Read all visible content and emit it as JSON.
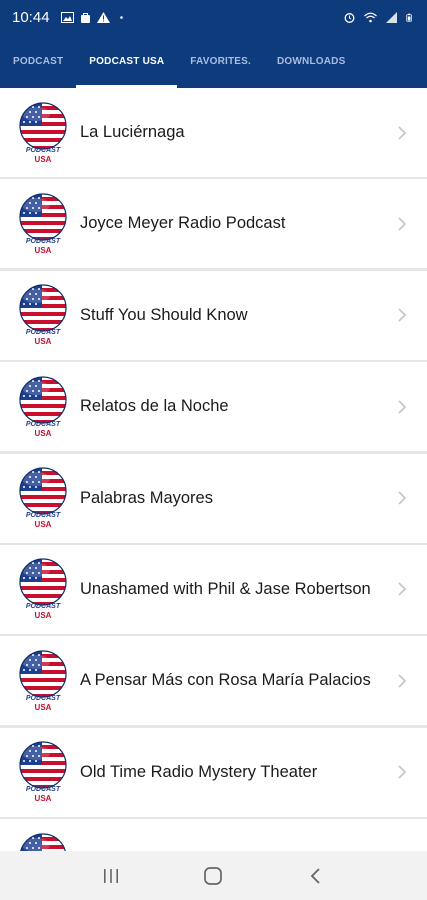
{
  "status_bar": {
    "time": "10:44",
    "left_icons": [
      "image-icon",
      "bag-icon",
      "warning-icon",
      "dot-icon"
    ],
    "right_icons": [
      "alarm-icon",
      "wifi-icon",
      "signal-icon",
      "battery-icon"
    ]
  },
  "tabs": [
    {
      "label": "PODCAST",
      "active": false
    },
    {
      "label": "PODCAST USA",
      "active": true
    },
    {
      "label": "FAVORITES.",
      "active": false
    },
    {
      "label": "DOWNLOADS",
      "active": false
    }
  ],
  "podcasts": [
    {
      "title": "La Luciérnaga"
    },
    {
      "title": "Joyce Meyer Radio Podcast"
    },
    {
      "title": "Stuff You Should Know"
    },
    {
      "title": "Relatos de la Noche"
    },
    {
      "title": "Palabras Mayores"
    },
    {
      "title": "Unashamed with Phil & Jase Robertson"
    },
    {
      "title": "A Pensar Más con Rosa María Palacios"
    },
    {
      "title": "Old Time Radio Mystery Theater"
    },
    {
      "title": ""
    }
  ],
  "logo": {
    "top_text": "PODCAST",
    "bottom_text": "USA"
  },
  "nav_bar": {
    "icons": [
      "recents-icon",
      "home-icon",
      "back-icon"
    ]
  },
  "colors": {
    "header_bg": "#0d3b7c",
    "tab_inactive": "#a9bde0",
    "list_bg": "#ffffff",
    "divider": "#e6e6e6"
  }
}
